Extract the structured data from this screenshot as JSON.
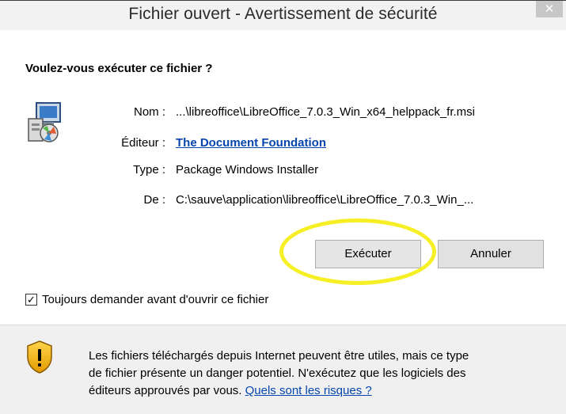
{
  "window": {
    "title": "Fichier ouvert - Avertissement de sécurité",
    "close_label": "✕"
  },
  "question": "Voulez-vous exécuter ce fichier ?",
  "fields": [
    {
      "label": "Nom :",
      "value": "...\\libreoffice\\LibreOffice_7.0.3_Win_x64_helppack_fr.msi"
    },
    {
      "label": "Éditeur :",
      "value": "The Document Foundation"
    },
    {
      "label": "Type :",
      "value": "Package Windows Installer"
    },
    {
      "label": "De :",
      "value": "C:\\sauve\\application\\libreoffice\\LibreOffice_7.0.3_Win_..."
    }
  ],
  "buttons": {
    "run": "Exécuter",
    "cancel": "Annuler"
  },
  "checkbox": {
    "label": "Toujours demander avant d'ouvrir ce fichier",
    "checked": true,
    "mark": "✓"
  },
  "footer": {
    "line1": "Les fichiers téléchargés depuis Internet peuvent être utiles, mais ce type",
    "line2": "de fichier présente un danger potentiel. N'exécutez que les logiciels des",
    "line3_prefix": "éditeurs approuvés par vous.",
    "risk_link": "Quels sont les risques ?"
  },
  "icons": {
    "file": "installer-package-icon",
    "warning": "security-shield-icon"
  },
  "colors": {
    "link": "#0645ad",
    "highlight": "#f7ef25"
  }
}
